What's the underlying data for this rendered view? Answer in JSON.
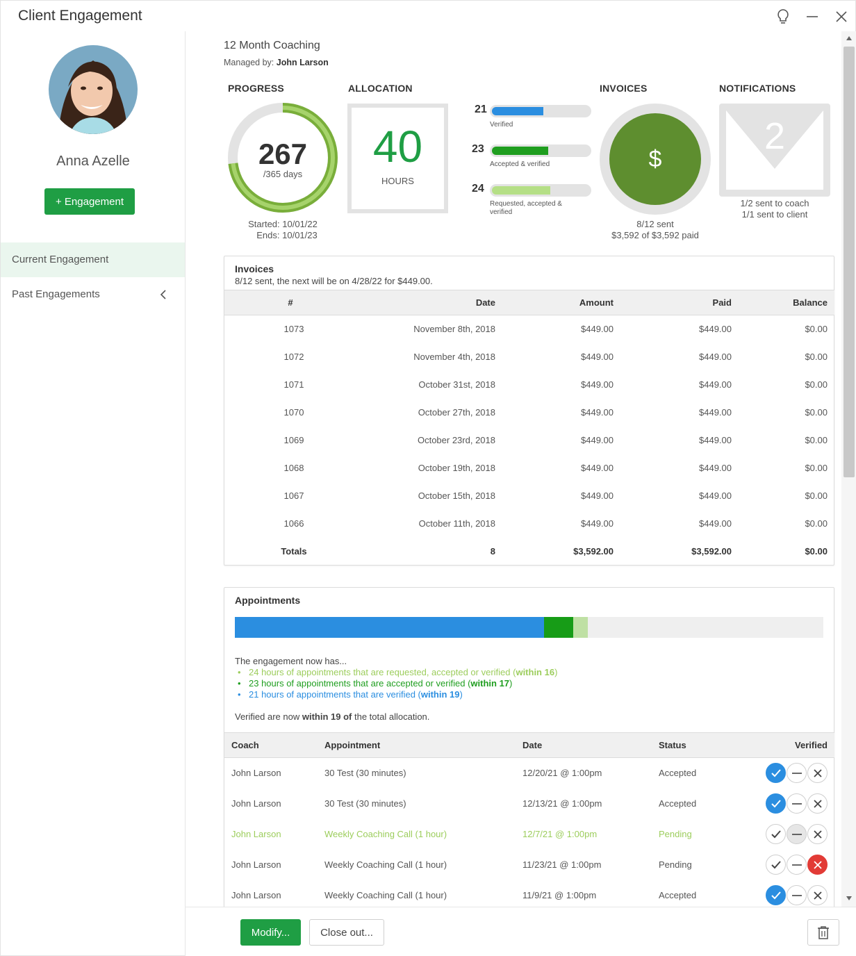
{
  "window": {
    "title": "Client Engagement"
  },
  "client": {
    "name": "Anna Azelle",
    "add_engagement_label": "+ Engagement"
  },
  "nav": {
    "current": "Current Engagement",
    "past": "Past Engagements"
  },
  "engagement": {
    "title": "12 Month Coaching",
    "managed_prefix": "Managed by:",
    "manager": "John Larson"
  },
  "progress": {
    "heading": "PROGRESS",
    "days": "267",
    "total_days": "/365 days",
    "fraction": 0.7315,
    "started": "Started: 10/01/22",
    "ends": "Ends: 10/01/23"
  },
  "allocation": {
    "heading": "ALLOCATION",
    "hours": "40",
    "unit": "HOURS",
    "bars": [
      {
        "num": "21",
        "label": "Verified",
        "fraction": 0.525,
        "color": "#2b8ee0"
      },
      {
        "num": "23",
        "label": "Accepted & verified",
        "fraction": 0.575,
        "color": "#1f9e1f"
      },
      {
        "num": "24",
        "label": "Requested, accepted & verified",
        "fraction": 0.6,
        "color": "#b5df86"
      }
    ]
  },
  "invoices_summary": {
    "heading": "INVOICES",
    "symbol": "$",
    "sent": "8/12 sent",
    "paid": "$3,592 of $3,592 paid"
  },
  "notifications": {
    "heading": "NOTIFICATIONS",
    "count": "2",
    "coach": "1/2 sent to coach",
    "client": "1/1 sent to client"
  },
  "invoices": {
    "title": "Invoices",
    "subtitle": "8/12 sent, the next will be on 4/28/22 for $449.00.",
    "columns": [
      "#",
      "Date",
      "Amount",
      "Paid",
      "Balance"
    ],
    "rows": [
      [
        "1073",
        "November 8th, 2018",
        "$449.00",
        "$449.00",
        "$0.00"
      ],
      [
        "1072",
        "November 4th, 2018",
        "$449.00",
        "$449.00",
        "$0.00"
      ],
      [
        "1071",
        "October 31st, 2018",
        "$449.00",
        "$449.00",
        "$0.00"
      ],
      [
        "1070",
        "October 27th, 2018",
        "$449.00",
        "$449.00",
        "$0.00"
      ],
      [
        "1069",
        "October 23rd, 2018",
        "$449.00",
        "$449.00",
        "$0.00"
      ],
      [
        "1068",
        "October 19th, 2018",
        "$449.00",
        "$449.00",
        "$0.00"
      ],
      [
        "1067",
        "October 15th, 2018",
        "$449.00",
        "$449.00",
        "$0.00"
      ],
      [
        "1066",
        "October 11th, 2018",
        "$449.00",
        "$449.00",
        "$0.00"
      ]
    ],
    "totals": [
      "Totals",
      "8",
      "$3,592.00",
      "$3,592.00",
      "$0.00"
    ]
  },
  "appointments": {
    "title": "Appointments",
    "bar_segments": [
      {
        "hours": 21,
        "color": "#2b8ee0"
      },
      {
        "hours": 2,
        "color": "#179c17"
      },
      {
        "hours": 1,
        "color": "#bfe0a4"
      }
    ],
    "intro": "The engagement now has...",
    "lines": [
      {
        "text": "24 hours of appointments that are requested, accepted or verified (",
        "bold": "within 16",
        "end": ")",
        "color": "#9ccd5c"
      },
      {
        "text": "23 hours of appointments that are accepted or verified (",
        "bold": "within 17",
        "end": ")",
        "color": "#1f9e1f"
      },
      {
        "text": "21 hours of appointments that are verified (",
        "bold": "within 19",
        "end": ")",
        "color": "#2b8ee0"
      }
    ],
    "verified_prefix": "Verified are now",
    "verified_bold": "within 19 of",
    "verified_suffix": "the total allocation.",
    "columns": [
      "Coach",
      "Appointment",
      "Date",
      "Status",
      "Verified"
    ],
    "rows": [
      {
        "coach": "John Larson",
        "appointment": "30 Test (30 minutes)",
        "date": "12/20/21 @ 1:00pm",
        "status": "Accepted",
        "state": "check",
        "style": ""
      },
      {
        "coach": "John Larson",
        "appointment": "30 Test (30 minutes)",
        "date": "12/13/21 @ 1:00pm",
        "status": "Accepted",
        "state": "check",
        "style": ""
      },
      {
        "coach": "John Larson",
        "appointment": "Weekly Coaching Call (1 hour)",
        "date": "12/7/21 @ 1:00pm",
        "status": "Pending",
        "state": "dash",
        "style": "pending-light"
      },
      {
        "coach": "John Larson",
        "appointment": "Weekly Coaching Call (1 hour)",
        "date": "11/23/21 @ 1:00pm",
        "status": "Pending",
        "state": "x",
        "style": ""
      },
      {
        "coach": "John Larson",
        "appointment": "Weekly Coaching Call (1 hour)",
        "date": "11/9/21 @ 1:00pm",
        "status": "Accepted",
        "state": "check",
        "style": ""
      }
    ]
  },
  "footer": {
    "modify_label": "Modify...",
    "close_out_label": "Close out..."
  },
  "icons": {
    "lightbulb": "lightbulb-icon",
    "minimize": "minimize-icon",
    "close": "close-icon",
    "trash": "trash-icon"
  }
}
